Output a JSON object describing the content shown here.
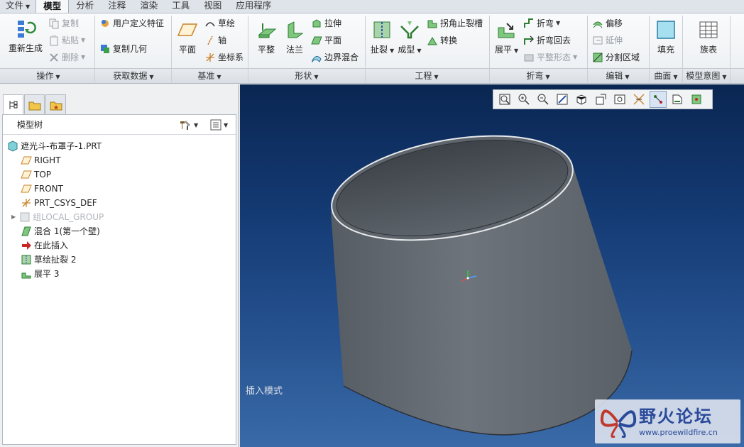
{
  "menu_tabs": [
    "文件",
    "模型",
    "分析",
    "注释",
    "渲染",
    "工具",
    "视图",
    "应用程序"
  ],
  "ribbon": {
    "operations": {
      "regen": "重新生成",
      "copy": "复制",
      "paste": "粘贴",
      "delete": "删除",
      "label": "操作"
    },
    "get_data": {
      "udf": "用户定义特征",
      "copy_geom": "复制几何",
      "label": "获取数据"
    },
    "datum": {
      "plane": "平面",
      "sketch": "草绘",
      "axis": "轴",
      "csys": "坐标系",
      "label": "基准"
    },
    "shapes": {
      "flat": "平整",
      "flange": "法兰",
      "extrude": "拉伸",
      "planar": "平面",
      "boundary_blend": "边界混合",
      "label": "形状"
    },
    "engineering": {
      "rip": "扯裂",
      "form": "成型",
      "corner_relief": "拐角止裂槽",
      "convert": "转换",
      "label": "工程"
    },
    "bends": {
      "unbend": "展平",
      "bend": "折弯",
      "bend_back": "折弯回去",
      "flat_state": "平整形态",
      "label": "折弯"
    },
    "editing": {
      "offset": "偏移",
      "extend": "延伸",
      "split_area": "分割区域",
      "label": "编辑"
    },
    "surfaces": {
      "fill": "填充",
      "label": "曲面"
    },
    "model_intent": {
      "family_table": "族表",
      "label": "模型意图"
    }
  },
  "model_tree": {
    "header": "模型树",
    "items": [
      "遮光斗-布罩子-1.PRT",
      "RIGHT",
      "TOP",
      "FRONT",
      "PRT_CSYS_DEF",
      "组LOCAL_GROUP",
      "混合 1(第一个壁)",
      "在此插入",
      "草绘扯裂 2",
      "展平 3"
    ]
  },
  "viewport": {
    "mode_text": "插入模式"
  },
  "watermark": {
    "title": "野火论坛",
    "url": "www.proewildfire.cn"
  },
  "colors": {
    "viewport_top": "#0a2652",
    "viewport_bottom": "#3a6aa8",
    "model_gray": "#6b7178",
    "watermark_text": "#2a4a9a"
  }
}
